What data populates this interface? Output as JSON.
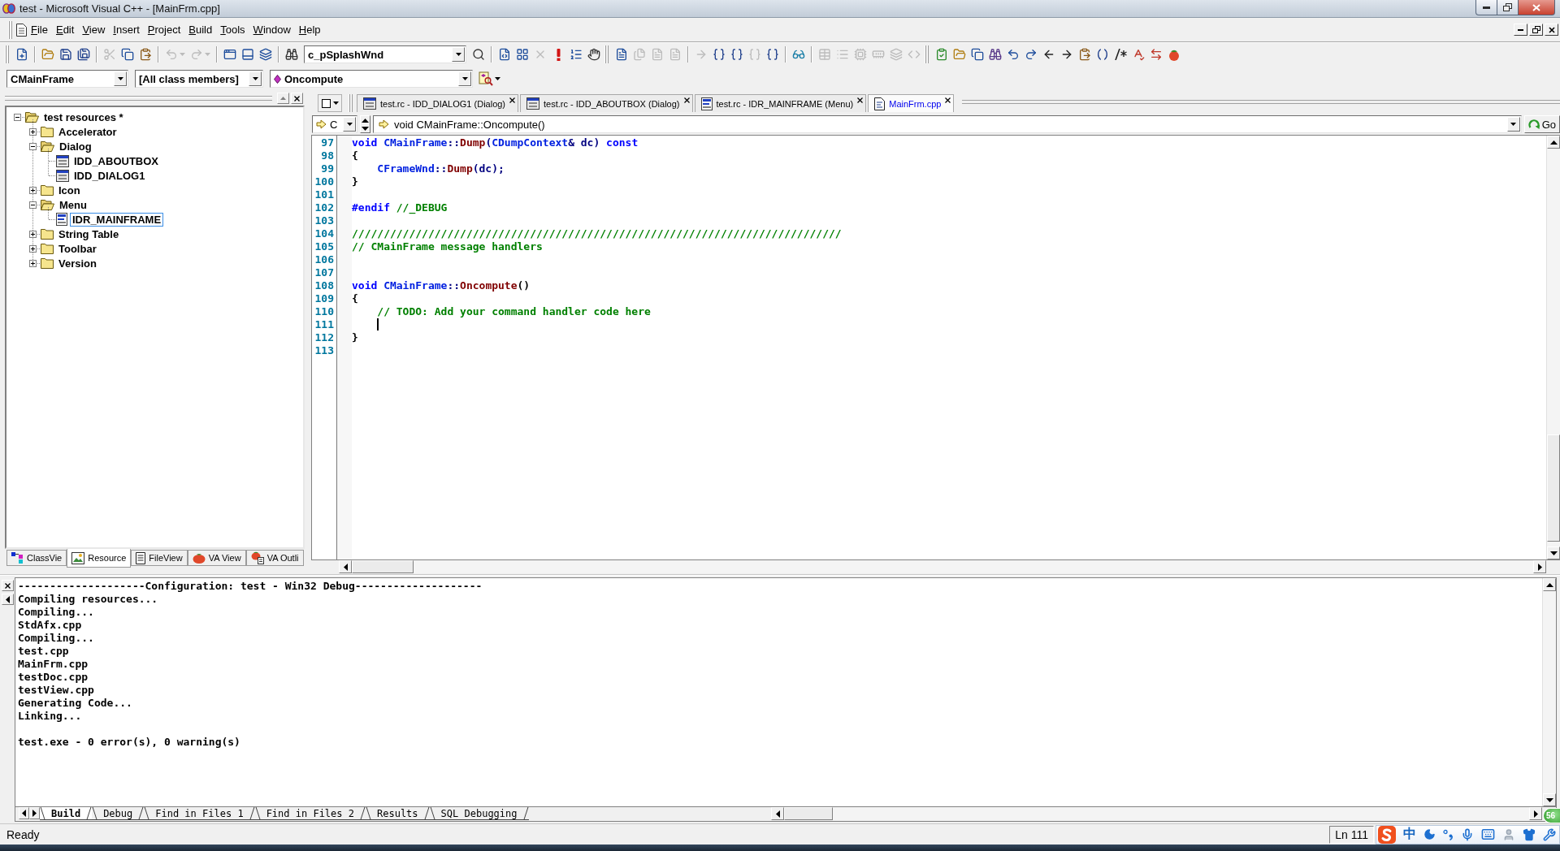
{
  "window": {
    "title": "test - Microsoft Visual C++ - [MainFrm.cpp]"
  },
  "menu": {
    "items": [
      "File",
      "Edit",
      "View",
      "Insert",
      "Project",
      "Build",
      "Tools",
      "Window",
      "Help"
    ]
  },
  "toolbar": [
    {
      "kind": "grip"
    },
    {
      "kind": "new-file",
      "disabled": false
    },
    {
      "kind": "separator"
    },
    {
      "kind": "open",
      "disabled": false
    },
    {
      "kind": "save",
      "disabled": false
    },
    {
      "kind": "save-all",
      "disabled": false
    },
    {
      "kind": "separator"
    },
    {
      "kind": "cut",
      "disabled": true
    },
    {
      "kind": "copy",
      "disabled": false
    },
    {
      "kind": "paste",
      "disabled": false
    },
    {
      "kind": "separator"
    },
    {
      "kind": "undo",
      "disabled": true
    },
    {
      "kind": "redo",
      "disabled": true
    },
    {
      "kind": "separator"
    },
    {
      "kind": "workspace",
      "disabled": false
    },
    {
      "kind": "output",
      "disabled": false
    },
    {
      "kind": "window-list",
      "disabled": false
    },
    {
      "kind": "separator"
    },
    {
      "kind": "find-in-files",
      "disabled": false
    },
    {
      "kind": "combo",
      "value": "c_pSplashWnd"
    },
    {
      "kind": "find",
      "disabled": false
    },
    {
      "kind": "separator"
    },
    {
      "kind": "compile",
      "disabled": false
    },
    {
      "kind": "build",
      "disabled": false
    },
    {
      "kind": "stop-build",
      "disabled": true
    },
    {
      "kind": "execute",
      "disabled": false
    },
    {
      "kind": "go",
      "disabled": false
    },
    {
      "kind": "breakpoint",
      "disabled": false
    },
    {
      "kind": "grip"
    },
    {
      "kind": "va-open",
      "disabled": false
    },
    {
      "kind": "va-a",
      "disabled": true
    },
    {
      "kind": "va-b",
      "disabled": true
    },
    {
      "kind": "va-c",
      "disabled": true
    },
    {
      "kind": "separator"
    },
    {
      "kind": "step",
      "disabled": true
    },
    {
      "kind": "step-into",
      "disabled": false
    },
    {
      "kind": "step-over",
      "disabled": false
    },
    {
      "kind": "step-out",
      "disabled": true
    },
    {
      "kind": "run-to-cursor",
      "disabled": false
    },
    {
      "kind": "separator"
    },
    {
      "kind": "quickwatch",
      "disabled": false
    },
    {
      "kind": "separator"
    },
    {
      "kind": "watch",
      "disabled": true
    },
    {
      "kind": "variables",
      "disabled": true
    },
    {
      "kind": "registers",
      "disabled": true
    },
    {
      "kind": "memory",
      "disabled": true
    },
    {
      "kind": "call-stack",
      "disabled": true
    },
    {
      "kind": "disassembly",
      "disabled": true
    },
    {
      "kind": "grip"
    },
    {
      "kind": "va-check",
      "disabled": false
    },
    {
      "kind": "va-folder",
      "disabled": false
    },
    {
      "kind": "va-copy",
      "disabled": false
    },
    {
      "kind": "va-tools",
      "disabled": false
    },
    {
      "kind": "va-undo",
      "disabled": false
    },
    {
      "kind": "va-redo",
      "disabled": false
    },
    {
      "kind": "back",
      "disabled": false
    },
    {
      "kind": "forward",
      "disabled": false
    },
    {
      "kind": "va-paste",
      "disabled": false
    },
    {
      "kind": "va-parens",
      "disabled": false
    },
    {
      "kind": "comment",
      "disabled": false
    },
    {
      "kind": "spell",
      "disabled": false
    },
    {
      "kind": "swap",
      "disabled": false
    },
    {
      "kind": "tomato",
      "disabled": false
    }
  ],
  "wizard_bar": {
    "class": "CMainFrame",
    "filter": "[All class members]",
    "member": "Oncompute"
  },
  "workspace": {
    "tree": [
      {
        "label": "test resources *",
        "kind": "folder",
        "expanded": true,
        "selected": false,
        "children": [
          {
            "label": "Accelerator",
            "kind": "folder",
            "expanded": false,
            "selected": false
          },
          {
            "label": "Dialog",
            "kind": "folder",
            "expanded": true,
            "selected": false,
            "children": [
              {
                "label": "IDD_ABOUTBOX",
                "kind": "dialog",
                "selected": false
              },
              {
                "label": "IDD_DIALOG1",
                "kind": "dialog",
                "selected": false
              }
            ]
          },
          {
            "label": "Icon",
            "kind": "folder",
            "expanded": false,
            "selected": false
          },
          {
            "label": "Menu",
            "kind": "folder",
            "expanded": true,
            "selected": false,
            "children": [
              {
                "label": "IDR_MAINFRAME",
                "kind": "menu",
                "selected": true
              }
            ]
          },
          {
            "label": "String Table",
            "kind": "folder",
            "expanded": false,
            "selected": false
          },
          {
            "label": "Toolbar",
            "kind": "folder",
            "expanded": false,
            "selected": false
          },
          {
            "label": "Version",
            "kind": "folder",
            "expanded": false,
            "selected": false
          }
        ]
      }
    ],
    "tabs": [
      {
        "label": "ClassVie",
        "kind": "class",
        "selected": false
      },
      {
        "label": "Resource",
        "kind": "resource",
        "selected": true
      },
      {
        "label": "FileView",
        "kind": "file",
        "selected": false
      },
      {
        "label": "VA View",
        "kind": "va-view",
        "selected": false
      },
      {
        "label": "VA Outli",
        "kind": "va-outline",
        "selected": false
      }
    ]
  },
  "editor": {
    "tabs": [
      {
        "label": "test.rc - IDD_DIALOG1 (Dialog)",
        "kind": "dialog",
        "selected": false
      },
      {
        "label": "test.rc - IDD_ABOUTBOX (Dialog)",
        "kind": "dialog",
        "selected": false
      },
      {
        "label": "test.rc - IDR_MAINFRAME (Menu)",
        "kind": "menu",
        "selected": false
      },
      {
        "label": "MainFrm.cpp",
        "kind": "source",
        "selected": true
      }
    ],
    "scope": "C",
    "location": "void CMainFrame::Oncompute()",
    "go_label": "Go",
    "lines": [
      {
        "number": "97",
        "caret": false,
        "tokens": [
          {
            "text": "void ",
            "kind": "keyword"
          },
          {
            "text": "CMainFrame",
            "kind": "type"
          },
          {
            "text": "::",
            "kind": "operator"
          },
          {
            "text": "Dump",
            "kind": "function"
          },
          {
            "text": "(",
            "kind": "operator"
          },
          {
            "text": "CDumpContext",
            "kind": "type"
          },
          {
            "text": "& dc) ",
            "kind": "operator"
          },
          {
            "text": "const",
            "kind": "keyword"
          }
        ]
      },
      {
        "number": "98",
        "caret": false,
        "tokens": [
          {
            "text": "{",
            "kind": "plain"
          }
        ]
      },
      {
        "number": "99",
        "caret": false,
        "tokens": [
          {
            "text": "    CFrameWnd",
            "kind": "type"
          },
          {
            "text": "::",
            "kind": "operator"
          },
          {
            "text": "Dump",
            "kind": "function"
          },
          {
            "text": "(dc);",
            "kind": "operator"
          }
        ]
      },
      {
        "number": "100",
        "caret": false,
        "tokens": [
          {
            "text": "}",
            "kind": "plain"
          }
        ]
      },
      {
        "number": "101",
        "caret": false
      },
      {
        "number": "102",
        "caret": false,
        "tokens": [
          {
            "text": "#endif ",
            "kind": "keyword"
          },
          {
            "text": "//_DEBUG",
            "kind": "comment"
          }
        ]
      },
      {
        "number": "103",
        "caret": false
      },
      {
        "number": "104",
        "caret": false,
        "tokens": [
          {
            "text": "/////////////////////////////////////////////////////////////////////////////",
            "kind": "comment"
          }
        ]
      },
      {
        "number": "105",
        "caret": false,
        "tokens": [
          {
            "text": "// CMainFrame message handlers",
            "kind": "comment"
          }
        ]
      },
      {
        "number": "106",
        "caret": false
      },
      {
        "number": "107",
        "caret": false
      },
      {
        "number": "108",
        "caret": false,
        "tokens": [
          {
            "text": "void ",
            "kind": "keyword"
          },
          {
            "text": "CMainFrame",
            "kind": "type"
          },
          {
            "text": "::",
            "kind": "operator"
          },
          {
            "text": "Oncompute",
            "kind": "function"
          },
          {
            "text": "()",
            "kind": "plain"
          }
        ]
      },
      {
        "number": "109",
        "caret": false,
        "tokens": [
          {
            "text": "{",
            "kind": "plain"
          }
        ]
      },
      {
        "number": "110",
        "caret": false,
        "tokens": [
          {
            "text": "    // TODO: Add your command handler code here",
            "kind": "comment"
          }
        ]
      },
      {
        "number": "111",
        "caret": true
      },
      {
        "number": "112",
        "caret": false,
        "tokens": [
          {
            "text": "}",
            "kind": "plain"
          }
        ]
      },
      {
        "number": "113",
        "caret": false
      }
    ]
  },
  "output": {
    "blocks": [
      [
        "--------------------Configuration: test - Win32 Debug--------------------",
        "Compiling resources...",
        "Compiling...",
        "StdAfx.cpp",
        "Compiling...",
        "test.cpp",
        "MainFrm.cpp",
        "testDoc.cpp",
        "testView.cpp",
        "Generating Code...",
        "Linking..."
      ],
      [
        "test.exe - 0 error(s), 0 warning(s)"
      ]
    ],
    "tabs": [
      {
        "label": "Build",
        "selected": true
      },
      {
        "label": "Debug",
        "selected": false
      },
      {
        "label": "Find in Files 1",
        "selected": false
      },
      {
        "label": "Find in Files 2",
        "selected": false
      },
      {
        "label": "Results",
        "selected": false
      },
      {
        "label": "SQL Debugging",
        "selected": false
      }
    ]
  },
  "status_bar": {
    "message": "Ready",
    "position": "Ln 111",
    "ime_mode": "中"
  },
  "speed_ball": {
    "label": "56"
  }
}
